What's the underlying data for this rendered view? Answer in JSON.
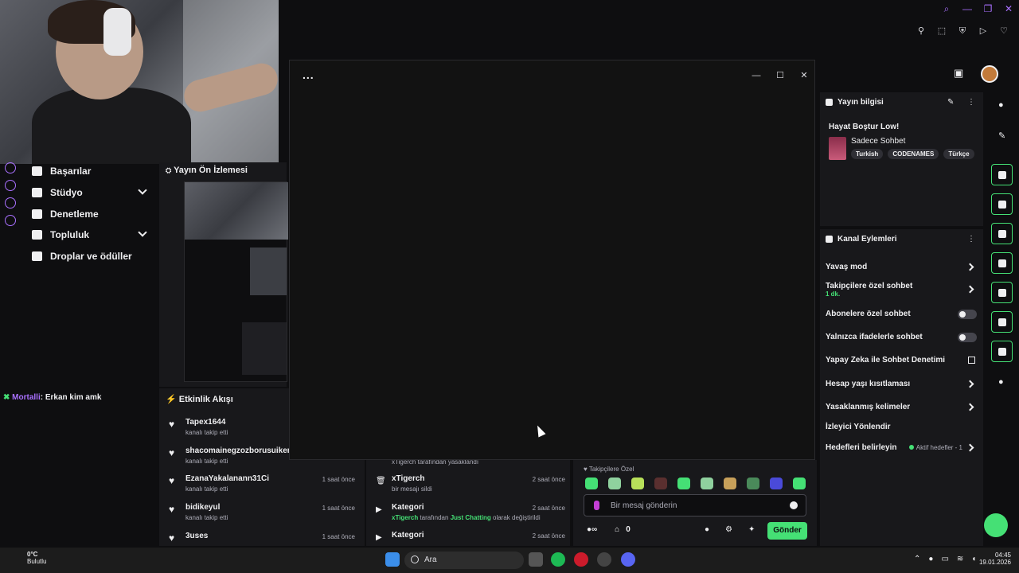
{
  "sidebar": {
    "items": [
      {
        "label": "Başarılar"
      },
      {
        "label": "Stüdyo"
      },
      {
        "label": "Denetleme"
      },
      {
        "label": "Topluluk"
      },
      {
        "label": "Droplar ve ödüller"
      }
    ]
  },
  "chat_overlay": {
    "user": "Mortalli",
    "message": ": Erkan kim amk"
  },
  "preview": {
    "title": "Yayın Ön İzlemesi"
  },
  "activity": {
    "title": "Etkinlik Akışı",
    "rows": [
      {
        "name": "Tapex1644",
        "sub": "kanalı takip etti",
        "time": ""
      },
      {
        "name": "shacomainegzozborusuiker",
        "sub": "kanalı takip etti",
        "time": ""
      },
      {
        "name": "EzanaYakalanann31Ci",
        "sub": "kanalı takip etti",
        "time": "1 saat önce"
      },
      {
        "name": "bidikeyul",
        "sub": "kanalı takip etti",
        "time": "1 saat önce"
      },
      {
        "name": "3uses",
        "sub": "",
        "time": "1 saat önce"
      }
    ]
  },
  "modlog": {
    "partial": "xTigerch tarafından yasaklandı",
    "rows": [
      {
        "name": "xTigerch",
        "sub": "bir mesajı sildi",
        "time": "2 saat önce"
      },
      {
        "name": "Kategori",
        "sub_user": "xTigerch",
        "sub_mid": " tarafından ",
        "sub_cat": "Just Chatting",
        "sub_end": " olarak değiştirildi",
        "time": "2 saat önce"
      },
      {
        "name": "Kategori",
        "time": "2 saat önce"
      }
    ]
  },
  "chat": {
    "mode_label": "Takipçilere Özel",
    "placeholder": "Bir mesaj gönderin",
    "points": "0",
    "send_label": "Gönder"
  },
  "window": {
    "menu": "..."
  },
  "stream_info": {
    "title": "Yayın bilgisi",
    "stream_title": "Hayat Boştur Low!",
    "category": "Sadece Sohbet",
    "tags": [
      "Turkish",
      "CODENAMES",
      "Türkçe"
    ]
  },
  "channel_actions": {
    "title": "Kanal Eylemleri",
    "items": [
      {
        "label": "Yavaş mod"
      },
      {
        "label": "Takipçilere özel sohbet",
        "sub": "1 dk."
      },
      {
        "label": "Abonelere özel sohbet"
      },
      {
        "label": "Yalnızca ifadelerle sohbet"
      },
      {
        "label": "Yapay Zeka ile Sohbet Denetimi"
      },
      {
        "label": "Hesap yaşı kısıtlaması"
      },
      {
        "label": "Yasaklanmış kelimeler"
      },
      {
        "label": "İzleyici Yönlendir"
      },
      {
        "label": "Hedefleri belirleyin",
        "goals": "Aktif hedefler - 1"
      }
    ]
  },
  "taskbar": {
    "temp": "0°C",
    "weather": "Bulutlu",
    "search": "Ara",
    "time": "04:45",
    "date": "19.01.2026"
  },
  "colors": {
    "accent_green": "#45e075",
    "accent_purple": "#a970ff",
    "background": "#0e0e10"
  }
}
